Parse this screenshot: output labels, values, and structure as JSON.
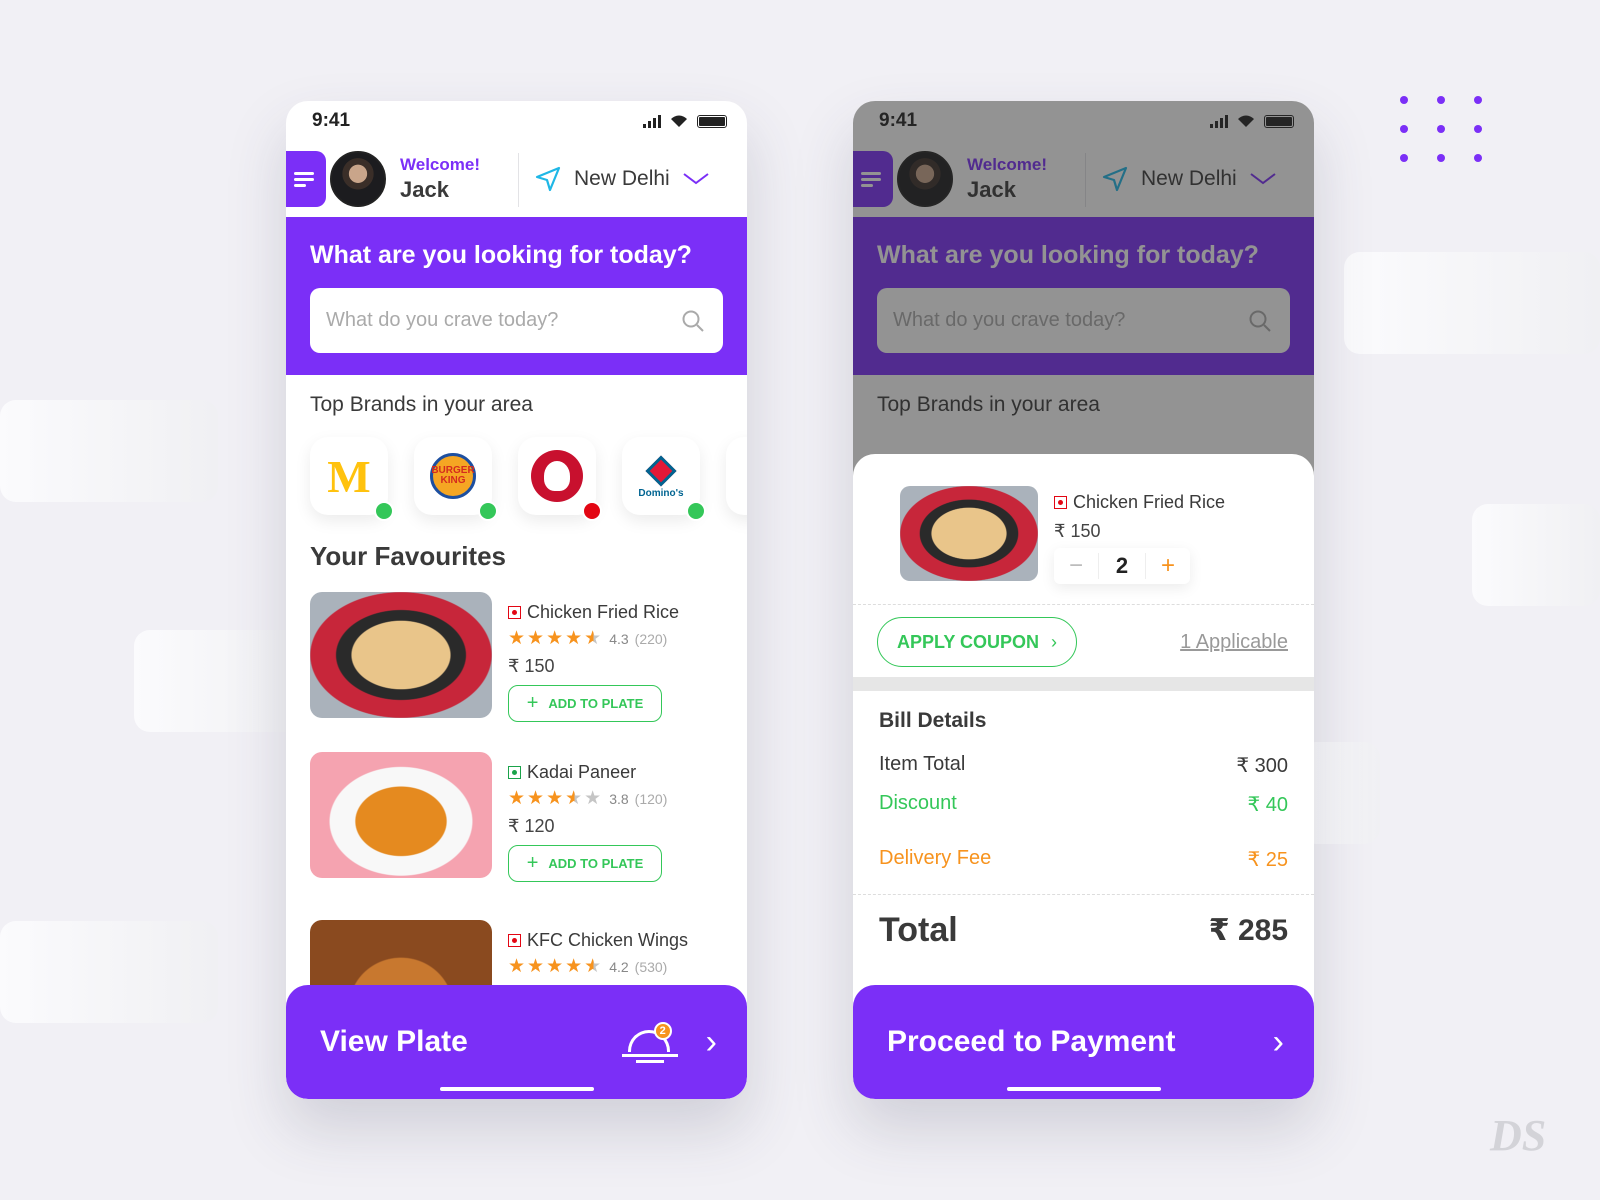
{
  "status_bar": {
    "time": "9:41"
  },
  "header": {
    "greeting": "Welcome!",
    "user_name": "Jack",
    "location": "New Delhi"
  },
  "hero": {
    "title": "What are you looking for today?",
    "search_placeholder": "What do you crave today?"
  },
  "brands": {
    "title": "Top Brands in your area",
    "items": [
      {
        "name": "McDonald's",
        "status": "open",
        "status_color": "#34c759"
      },
      {
        "name": "Burger King",
        "status": "open",
        "status_color": "#34c759"
      },
      {
        "name": "KFC",
        "status": "closed",
        "status_color": "#e30613"
      },
      {
        "name": "Domino's",
        "status": "open",
        "status_color": "#34c759",
        "logo_text": "Domino's"
      }
    ],
    "bk_logo_text": "BURGER KING"
  },
  "favourites": {
    "title": "Your Favourites",
    "items": [
      {
        "name": "Chicken Fried Rice",
        "type": "non-veg",
        "rating": "4.3",
        "reviews": "(220)",
        "stars": 4.5,
        "price": "₹ 150",
        "button": "ADD TO PLATE"
      },
      {
        "name": "Kadai Paneer",
        "type": "veg",
        "rating": "3.8",
        "reviews": "(120)",
        "stars": 3.5,
        "price": "₹ 120",
        "button": "ADD TO PLATE"
      },
      {
        "name": "KFC Chicken Wings",
        "type": "non-veg",
        "rating": "4.2",
        "reviews": "(530)",
        "stars": 4.5
      }
    ]
  },
  "view_plate": {
    "label": "View Plate",
    "badge_count": "2"
  },
  "cart": {
    "item": {
      "name": "Chicken Fried Rice",
      "price": "₹ 150",
      "quantity": "2",
      "minus": "−",
      "plus": "+"
    },
    "coupon_button": "APPLY COUPON",
    "coupon_applicable": "1 Applicable",
    "bill": {
      "title": "Bill Details",
      "item_total_label": "Item Total",
      "item_total": "₹ 300",
      "discount_label": "Discount",
      "discount": "₹ 40",
      "delivery_label": "Delivery Fee",
      "delivery": "₹ 25",
      "total_label": "Total",
      "total": "₹ 285"
    },
    "proceed_button": "Proceed to Payment"
  },
  "colors": {
    "primary": "#7b2ff7",
    "success": "#34c759",
    "accent": "#f7931e",
    "nonveg": "#e30613"
  }
}
